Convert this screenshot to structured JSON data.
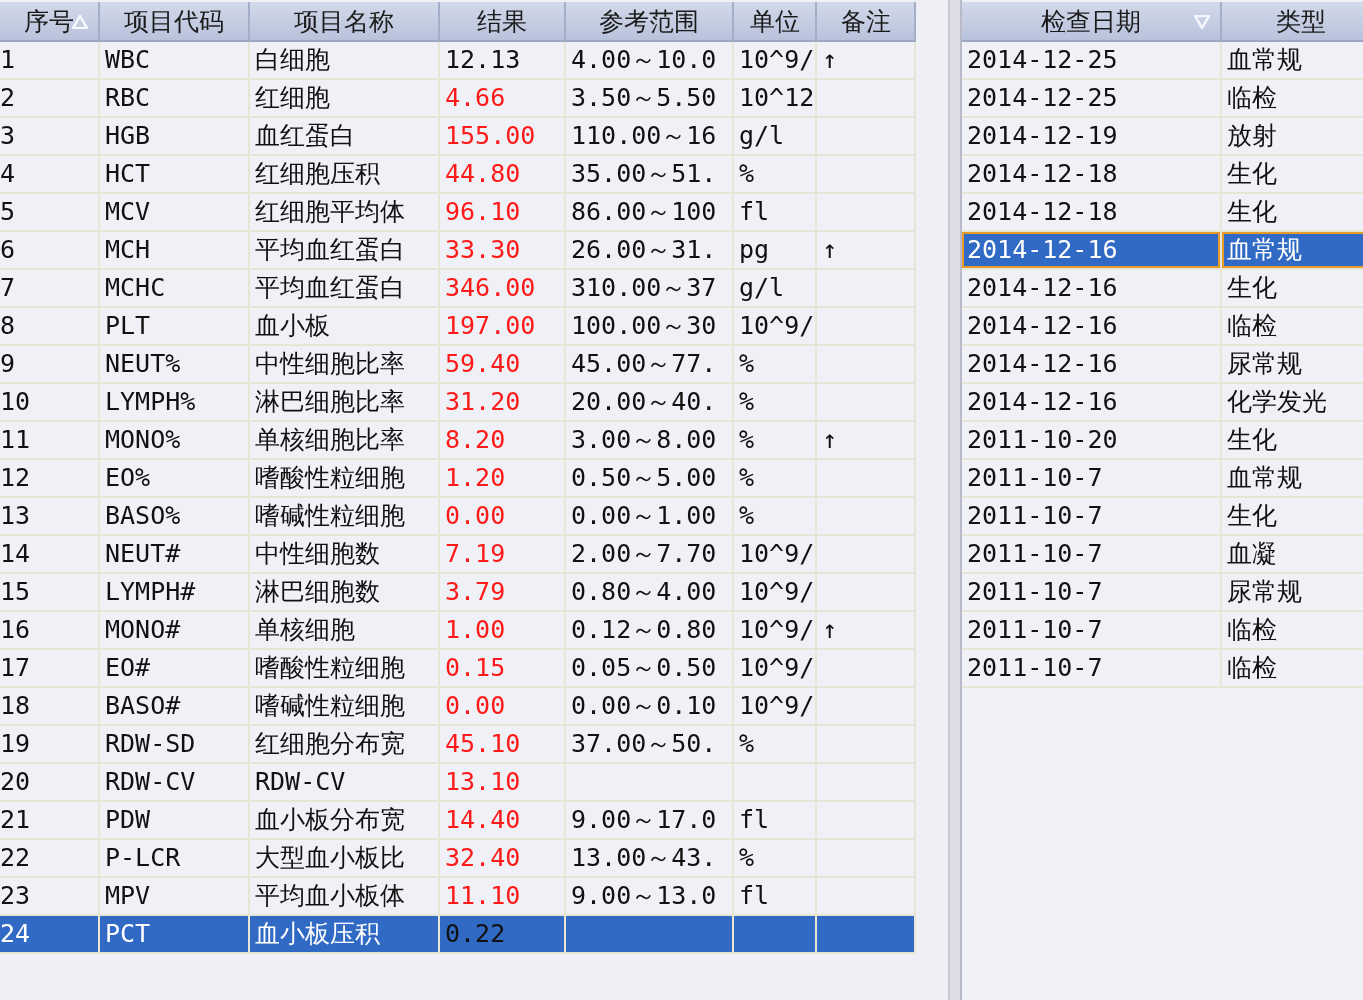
{
  "results_table": {
    "columns": [
      {
        "label": "序号",
        "sorted": true,
        "ascending": true
      },
      {
        "label": "项目代码",
        "sorted": false
      },
      {
        "label": "项目名称",
        "sorted": false
      },
      {
        "label": "结果",
        "sorted": false
      },
      {
        "label": "参考范围",
        "sorted": false
      },
      {
        "label": "单位",
        "sorted": false
      },
      {
        "label": "备注",
        "sorted": false
      }
    ],
    "rows": [
      {
        "no": "1",
        "code": "WBC",
        "name": "白细胞",
        "result": "12.13",
        "flagged": false,
        "range": "4.00～10.0",
        "unit": "10^9/",
        "note": "↑",
        "selected": false
      },
      {
        "no": "2",
        "code": "RBC",
        "name": "红细胞",
        "result": "4.66",
        "flagged": true,
        "range": "3.50～5.50",
        "unit": "10^12",
        "selected": false
      },
      {
        "no": "3",
        "code": "HGB",
        "name": "血红蛋白",
        "result": "155.00",
        "flagged": true,
        "range": "110.00～16",
        "unit": "g/l",
        "selected": false
      },
      {
        "no": "4",
        "code": "HCT",
        "name": "红细胞压积",
        "result": "44.80",
        "flagged": true,
        "range": "35.00～51.",
        "unit": "%",
        "selected": false
      },
      {
        "no": "5",
        "code": "MCV",
        "name": "红细胞平均体",
        "result": "96.10",
        "flagged": true,
        "range": "86.00～100",
        "unit": "fl",
        "selected": false
      },
      {
        "no": "6",
        "code": "MCH",
        "name": "平均血红蛋白",
        "result": "33.30",
        "flagged": true,
        "range": "26.00～31.",
        "unit": "pg",
        "note": "↑",
        "selected": false
      },
      {
        "no": "7",
        "code": "MCHC",
        "name": "平均血红蛋白",
        "result": "346.00",
        "flagged": true,
        "range": "310.00～37",
        "unit": "g/l",
        "selected": false
      },
      {
        "no": "8",
        "code": "PLT",
        "name": "血小板",
        "result": "197.00",
        "flagged": true,
        "range": "100.00～30",
        "unit": "10^9/",
        "selected": false
      },
      {
        "no": "9",
        "code": "NEUT%",
        "name": "中性细胞比率",
        "result": "59.40",
        "flagged": true,
        "range": "45.00～77.",
        "unit": "%",
        "selected": false
      },
      {
        "no": "10",
        "code": "LYMPH%",
        "name": "淋巴细胞比率",
        "result": "31.20",
        "flagged": true,
        "range": "20.00～40.",
        "unit": "%",
        "selected": false
      },
      {
        "no": "11",
        "code": "MONO%",
        "name": "单核细胞比率",
        "result": "8.20",
        "flagged": true,
        "range": "3.00～8.00",
        "unit": "%",
        "note": "↑",
        "selected": false
      },
      {
        "no": "12",
        "code": "EO%",
        "name": "嗜酸性粒细胞",
        "result": "1.20",
        "flagged": true,
        "range": "0.50～5.00",
        "unit": "%",
        "selected": false
      },
      {
        "no": "13",
        "code": "BASO%",
        "name": "嗜碱性粒细胞",
        "result": "0.00",
        "flagged": true,
        "range": "0.00～1.00",
        "unit": "%",
        "selected": false
      },
      {
        "no": "14",
        "code": "NEUT#",
        "name": "中性细胞数",
        "result": "7.19",
        "flagged": true,
        "range": "2.00～7.70",
        "unit": "10^9/",
        "selected": false
      },
      {
        "no": "15",
        "code": "LYMPH#",
        "name": "淋巴细胞数",
        "result": "3.79",
        "flagged": true,
        "range": "0.80～4.00",
        "unit": "10^9/",
        "selected": false
      },
      {
        "no": "16",
        "code": "MONO#",
        "name": "单核细胞",
        "result": "1.00",
        "flagged": true,
        "range": "0.12～0.80",
        "unit": "10^9/",
        "note": "↑",
        "selected": false
      },
      {
        "no": "17",
        "code": "EO#",
        "name": "嗜酸性粒细胞",
        "result": "0.15",
        "flagged": true,
        "range": "0.05～0.50",
        "unit": "10^9/",
        "selected": false
      },
      {
        "no": "18",
        "code": "BASO#",
        "name": "嗜碱性粒细胞",
        "result": "0.00",
        "flagged": true,
        "range": "0.00～0.10",
        "unit": "10^9/",
        "selected": false
      },
      {
        "no": "19",
        "code": "RDW-SD",
        "name": "红细胞分布宽",
        "result": "45.10",
        "flagged": true,
        "range": "37.00～50.",
        "unit": "%",
        "selected": false
      },
      {
        "no": "20",
        "code": "RDW-CV",
        "name": "RDW-CV",
        "result": "13.10",
        "flagged": true,
        "selected": false
      },
      {
        "no": "21",
        "code": "PDW",
        "name": "血小板分布宽",
        "result": "14.40",
        "flagged": true,
        "range": "9.00～17.0",
        "unit": "fl",
        "selected": false
      },
      {
        "no": "22",
        "code": "P-LCR",
        "name": "大型血小板比",
        "result": "32.40",
        "flagged": true,
        "range": "13.00～43.",
        "unit": "%",
        "selected": false
      },
      {
        "no": "23",
        "code": "MPV",
        "name": "平均血小板体",
        "result": "11.10",
        "flagged": true,
        "range": "9.00～13.0",
        "unit": "fl",
        "selected": false
      },
      {
        "no": "24",
        "code": "PCT",
        "name": "血小板压积",
        "result": "0.22",
        "flagged": false,
        "selected": true
      }
    ]
  },
  "exam_table": {
    "columns": [
      {
        "label": "检查日期",
        "sorted": true,
        "ascending": false
      },
      {
        "label": "类型",
        "sorted": false
      }
    ],
    "rows": [
      {
        "date": "2014-12-25",
        "type": "血常规",
        "selected": false
      },
      {
        "date": "2014-12-25",
        "type": "临检",
        "selected": false
      },
      {
        "date": "2014-12-19",
        "type": "放射",
        "selected": false
      },
      {
        "date": "2014-12-18",
        "type": "生化",
        "selected": false
      },
      {
        "date": "2014-12-18",
        "type": "生化",
        "selected": false
      },
      {
        "date": "2014-12-16",
        "type": "血常规",
        "selected": true
      },
      {
        "date": "2014-12-16",
        "type": "生化",
        "selected": false
      },
      {
        "date": "2014-12-16",
        "type": "临检",
        "selected": false
      },
      {
        "date": "2014-12-16",
        "type": "尿常规",
        "selected": false
      },
      {
        "date": "2014-12-16",
        "type": "化学发光",
        "selected": false
      },
      {
        "date": "2011-10-20",
        "type": "生化",
        "selected": false
      },
      {
        "date": "2011-10-7",
        "type": "血常规",
        "selected": false
      },
      {
        "date": "2011-10-7",
        "type": "生化",
        "selected": false
      },
      {
        "date": "2011-10-7",
        "type": "血凝",
        "selected": false
      },
      {
        "date": "2011-10-7",
        "type": "尿常规",
        "selected": false
      },
      {
        "date": "2011-10-7",
        "type": "临检",
        "selected": false
      },
      {
        "date": "2011-10-7",
        "type": "临检",
        "selected": false
      }
    ]
  }
}
